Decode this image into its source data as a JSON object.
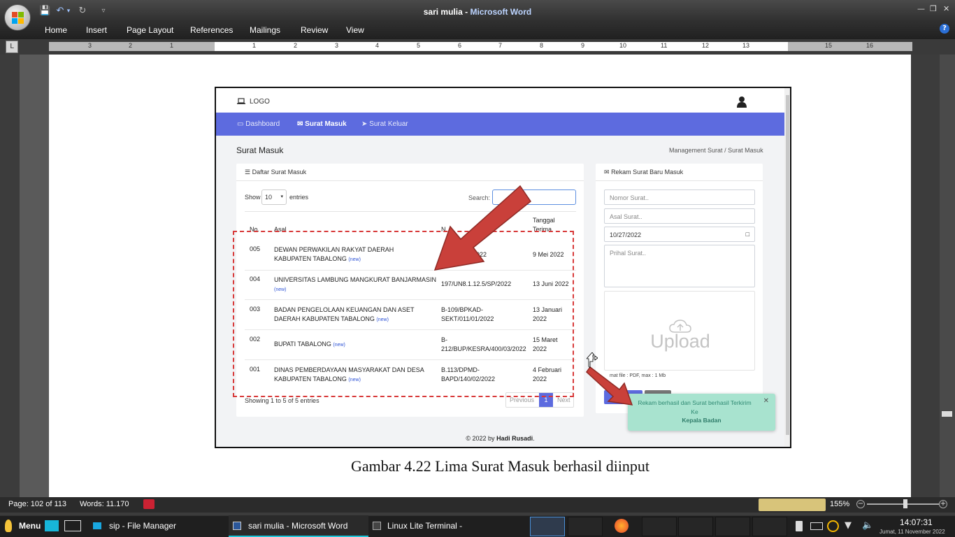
{
  "window": {
    "doc_name": "sari mulia",
    "separator": " - ",
    "app_name": "Microsoft Word",
    "minimize": "—",
    "restore": "❒",
    "close": "✕"
  },
  "quick_access": [
    {
      "name": "save-icon",
      "glyph": "💾"
    },
    {
      "name": "undo-icon",
      "glyph": "↶"
    },
    {
      "name": "undo-dropdown-icon",
      "glyph": "▾"
    },
    {
      "name": "redo-icon",
      "glyph": "↻"
    },
    {
      "name": "customize-qat-icon",
      "glyph": "▿"
    }
  ],
  "ribbon_tabs": [
    "Home",
    "Insert",
    "Page Layout",
    "References",
    "Mailings",
    "Review",
    "View"
  ],
  "help_label": "?",
  "ruler_toggle": "L",
  "ruler_numbers": [
    "3",
    "2",
    "1",
    "1",
    "2",
    "3",
    "4",
    "5",
    "6",
    "7",
    "8",
    "9",
    "10",
    "11",
    "12",
    "13",
    "15",
    "16"
  ],
  "webapp": {
    "logo_icon": "laptop-icon",
    "logo_text": "LOGO",
    "user_icon": "user-icon",
    "nav": [
      {
        "label": "Dashboard",
        "icon": "monitor-icon"
      },
      {
        "label": "Surat Masuk",
        "icon": "envelope-icon",
        "active": true
      },
      {
        "label": "Surat Keluar",
        "icon": "send-icon"
      }
    ],
    "page_title": "Surat Masuk",
    "breadcrumb": [
      "Management Surat",
      "/",
      "Surat Masuk"
    ],
    "list_card": {
      "title": "Daftar Surat Masuk",
      "show_label": "Show",
      "entries_value": "10",
      "entries_label": "entries",
      "search_label": "Search:",
      "columns": [
        "No.",
        "Asal",
        "N",
        "Tanggal Terima"
      ],
      "rows": [
        {
          "no": "005",
          "asal": "DEWAN PERWAKILAN RAKYAT DAERAH KABUPATEN TABALONG",
          "new": "(new)",
          "nomor": "AD/170/05/2022",
          "tanggal": "9 Mei 2022"
        },
        {
          "no": "004",
          "asal": "UNIVERSITAS LAMBUNG MANGKURAT BANJARMASIN",
          "new": "(new)",
          "nomor": "197/UN8.1.12.5/SP/2022",
          "tanggal": "13 Juni 2022"
        },
        {
          "no": "003",
          "asal": "BADAN PENGELOLAAN KEUANGAN DAN ASET DAERAH KABUPATEN TABALONG",
          "new": "(new)",
          "nomor": "B-109/BPKAD-SEKT/011/01/2022",
          "tanggal": "13 Januari 2022"
        },
        {
          "no": "002",
          "asal": "BUPATI TABALONG",
          "new": "(new)",
          "nomor": "B-212/BUP/KESRA/400/03/2022",
          "tanggal": "15 Maret 2022"
        },
        {
          "no": "001",
          "asal": "DINAS PEMBERDAYAAN MASYARAKAT DAN DESA KABUPATEN TABALONG",
          "new": "(new)",
          "nomor": "B.113/DPMD-BAPD/140/02/2022",
          "tanggal": "4 Februari 2022"
        }
      ],
      "info": "Showing 1 to 5 of 5 entries",
      "prev": "Previous",
      "page": "1",
      "next": "Next"
    },
    "form_card": {
      "title": "Rekam Surat Baru Masuk",
      "nomor_placeholder": "Nomor Surat..",
      "asal_placeholder": "Asal Surat..",
      "date_value": "10/27/2022",
      "perihal_placeholder": "Prihal Surat..",
      "upload_label": "Upload",
      "format_note": "mat file : PDF, max : 1 Mb"
    },
    "toast": {
      "message": "Rekam berhasil dan Surat berhasil Terkirim Ke",
      "recipient": "Kepala Badan",
      "close": "✕"
    },
    "footer_prefix": "© 2022 by",
    "footer_author": "Hadi Rusadi",
    "footer_suffix": "."
  },
  "caption": "Gambar 4.22 Lima Surat Masuk berhasil diinput",
  "statusbar": {
    "page": "Page: 102 of 113",
    "words": "Words: 11.170",
    "zoom": "155%"
  },
  "taskbar": {
    "menu": "Menu",
    "items": [
      {
        "label": "sip - File Manager",
        "icon": "folder-icon"
      },
      {
        "label": "sari mulia - Microsoft Word",
        "icon": "word-icon"
      },
      {
        "label": "Linux Lite Terminal -",
        "icon": "terminal-icon"
      }
    ],
    "time": "14:07:31",
    "date": "Jumat, 11 November 2022"
  },
  "colors": {
    "nav_bg": "#5d6bdf",
    "arrow_red": "#c9403a",
    "toast_bg": "#a8e3cf",
    "dashed_red": "#d83a3a"
  }
}
